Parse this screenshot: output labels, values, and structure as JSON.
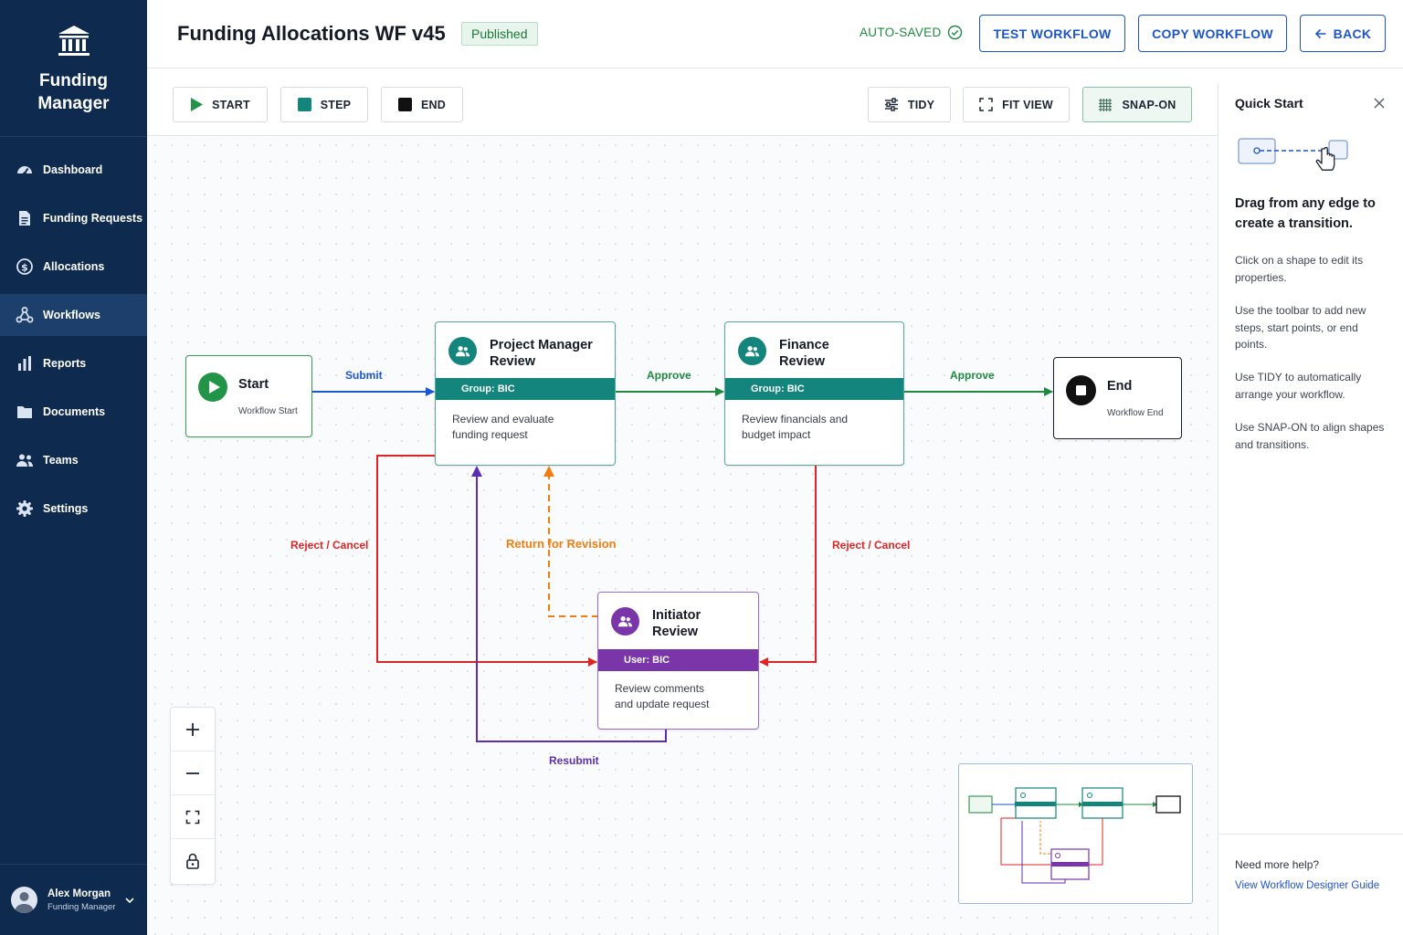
{
  "app": {
    "name": "Funding\nManager"
  },
  "sidebar": {
    "items": [
      {
        "label": "Dashboard",
        "icon": "dashboard-gauge-icon"
      },
      {
        "label": "Funding Requests",
        "icon": "document-icon"
      },
      {
        "label": "Allocations",
        "icon": "dollar-circle-icon"
      },
      {
        "label": "Workflows",
        "icon": "workflow-nodes-icon",
        "active": true
      },
      {
        "label": "Reports",
        "icon": "bar-chart-icon"
      },
      {
        "label": "Documents",
        "icon": "folder-icon"
      },
      {
        "label": "Teams",
        "icon": "people-icon"
      },
      {
        "label": "Settings",
        "icon": "gear-icon"
      }
    ],
    "user": {
      "name": "Alex Morgan",
      "role": "Funding Manager"
    }
  },
  "header": {
    "title": "Funding Allocations WF v45",
    "status_badge": "Published",
    "autosaved": "AUTO-SAVED",
    "test_button": "TEST WORKFLOW",
    "copy_button": "COPY WORKFLOW",
    "back_button": "BACK"
  },
  "toolbar": {
    "start": "START",
    "step": "STEP",
    "end": "END",
    "tidy": "TIDY",
    "fit_view": "FIT VIEW",
    "snap_on": "SNAP-ON"
  },
  "canvas": {
    "start_node": {
      "title": "Start",
      "subtitle": "Workflow Start"
    },
    "end_node": {
      "title": "End",
      "subtitle": "Workflow End"
    },
    "steps": [
      {
        "title": "Project Manager Review",
        "band": "Group: BIC",
        "description": "Review and evaluate funding request",
        "color": "#14857c"
      },
      {
        "title": "Finance Review",
        "band": "Group: BIC",
        "description": "Review financials and budget impact",
        "color": "#14857c"
      },
      {
        "title": "Initiator Review",
        "band": "User: BIC",
        "description": "Review comments and update request",
        "color": "#7a36a8"
      }
    ],
    "transitions": {
      "submit": "Submit",
      "approve_1": "Approve",
      "approve_2": "Approve",
      "reject_left": "Reject / Cancel",
      "reject_right": "Reject / Cancel",
      "return_for_revision": "Return for Revision",
      "resubmit": "Resubmit"
    },
    "colors": {
      "submit": "#1a56d6",
      "approve": "#1e8a41",
      "reject": "#e02424",
      "revision": "#ef7d10",
      "resubmit": "#5b2fb3"
    }
  },
  "quick_start": {
    "title": "Quick Start",
    "heading": "Drag from any edge to create a transition.",
    "tips": [
      "Click on a shape to edit its properties.",
      "Use the toolbar to add new steps, start points, or end points.",
      "Use TIDY to automatically arrange your workflow.",
      "Use SNAP-ON to align shapes and transitions."
    ],
    "help_text": "Need more help?",
    "guide_link": "View Workflow Designer Guide"
  }
}
